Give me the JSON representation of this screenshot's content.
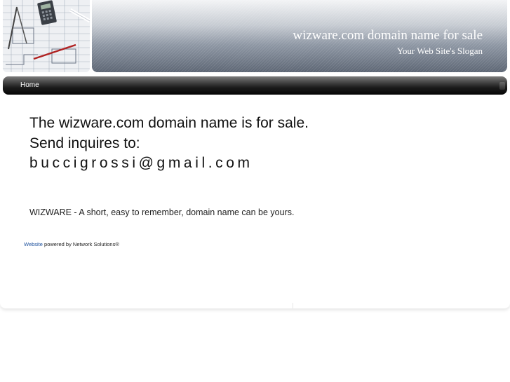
{
  "header": {
    "title": "wizware.com domain name for sale",
    "slogan": "Your Web Site's Slogan"
  },
  "nav": {
    "items": [
      {
        "label": "Home"
      }
    ]
  },
  "main": {
    "sale_line": "The wizware.com domain name is for sale.",
    "inquiry_line": "Send inquires to:",
    "email": "buccigrossi@gmail.com",
    "tagline": "WIZWARE - A short, easy to remember, domain name can be yours."
  },
  "footer": {
    "link_text": "Website",
    "text": " powered by Network Solutions®"
  },
  "colors": {
    "navbar": "#1b1b1b",
    "banner": "#8e97a4",
    "link": "#1b4f9c"
  }
}
